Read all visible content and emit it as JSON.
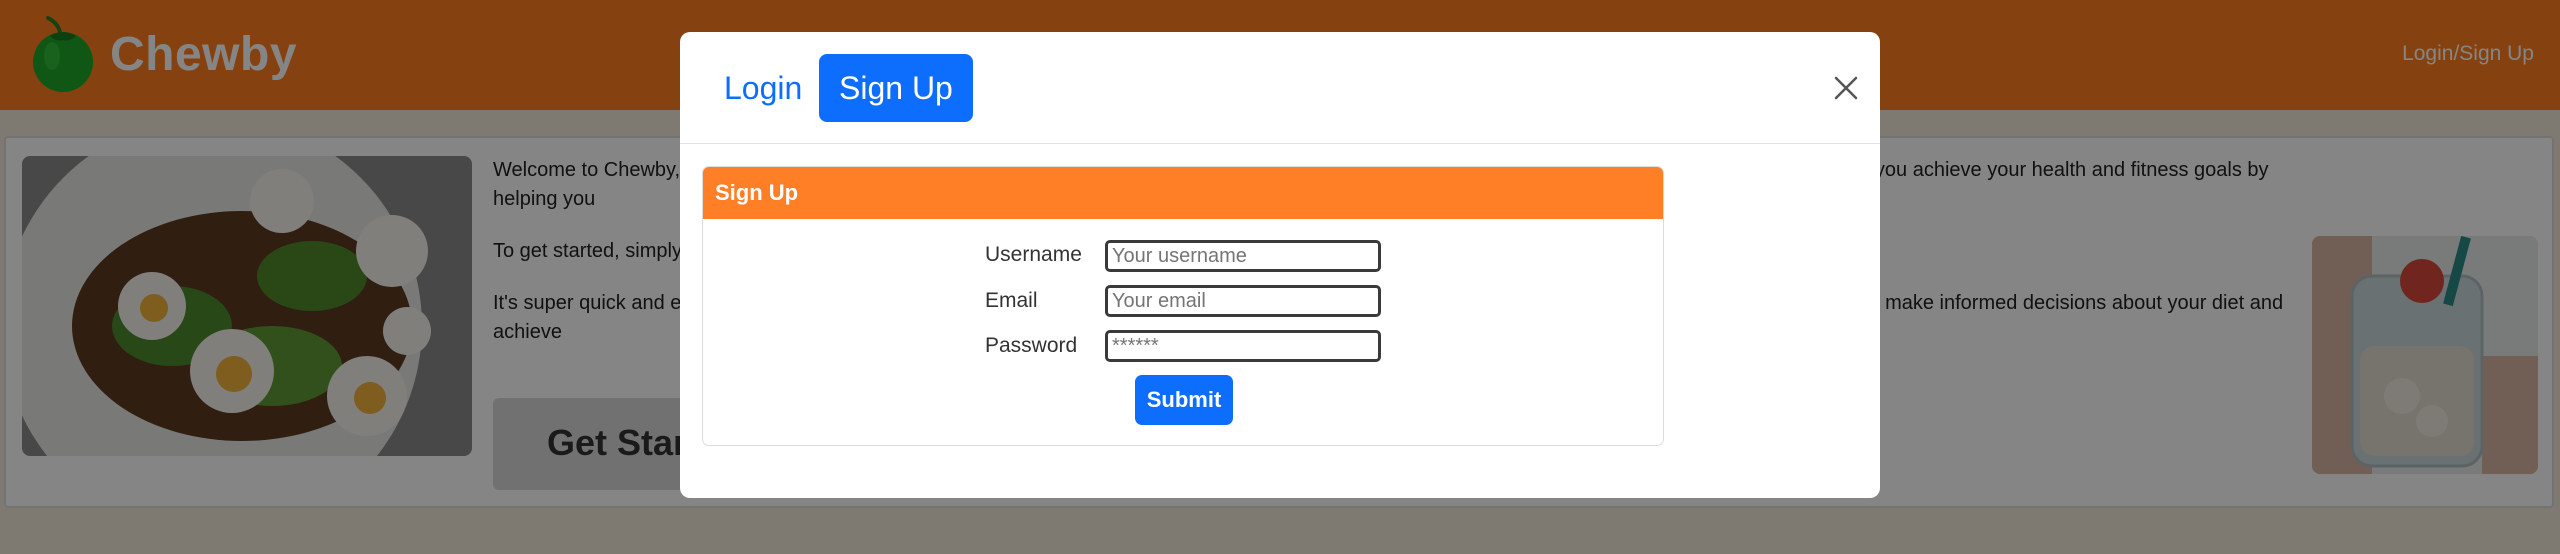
{
  "navbar": {
    "brand_name": "Chewby",
    "login_signup_link": "Login/Sign Up"
  },
  "main": {
    "paragraph_1": "Welcome to Chewby, the app that tracks your meals and helps you make better decisions about what to eat throughout the day. Our app is designed to help you achieve your health and fitness goals by helping you",
    "paragraph_2": "To get started, simply",
    "paragraph_3": "It's super quick and easy to use. This feature allows you to stay accountable and make informed decisions about your diet and achieve the goals you need to make informed decisions about your diet and achieve",
    "cta_label": "Get Started"
  },
  "modal": {
    "tabs": [
      {
        "label": "Login",
        "active": false
      },
      {
        "label": "Sign Up",
        "active": true
      }
    ],
    "form": {
      "title": "Sign Up",
      "username_label": "Username",
      "username_placeholder": "Your username",
      "email_label": "Email",
      "email_placeholder": "Your email",
      "password_label": "Password",
      "password_placeholder": "******",
      "submit_label": "Submit"
    }
  },
  "icons": {
    "logo": "pepper-logo-icon",
    "close": "close-icon"
  },
  "colors": {
    "navbar": "#ff7f1f",
    "card_header": "#ff7f27",
    "primary": "#0d6efd"
  }
}
